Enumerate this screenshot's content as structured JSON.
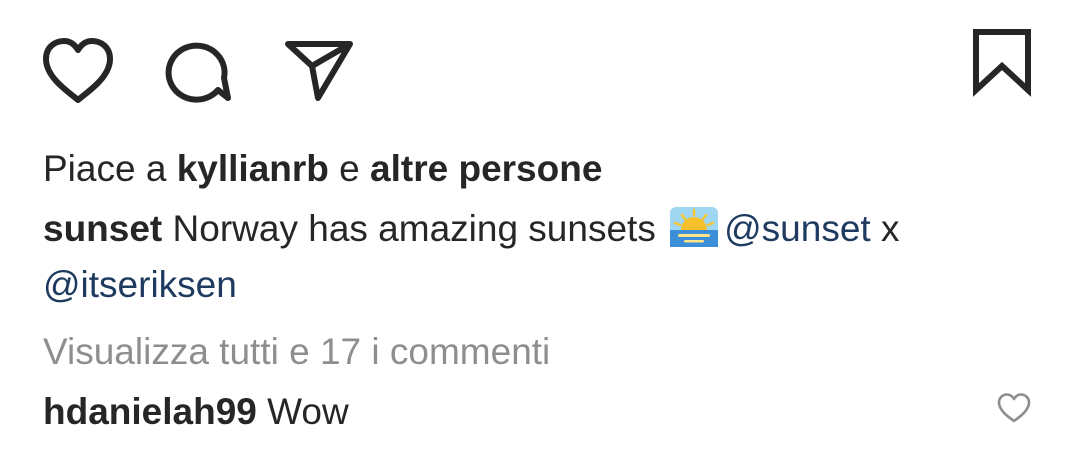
{
  "actions": {
    "like_icon": "heart-icon",
    "comment_icon": "speech-bubble-icon",
    "share_icon": "paper-plane-icon",
    "save_icon": "bookmark-icon"
  },
  "likes": {
    "prefix": "Piace a ",
    "user": "kyllianrb",
    "connector": " e ",
    "others": "altre persone"
  },
  "caption": {
    "username": "sunset",
    "text": "Norway has amazing sunsets",
    "emoji_icon": "sunrise-emoji",
    "mention1": "@sunset",
    "separator": "x",
    "mention2": "@itseriksen"
  },
  "view_comments": "Visualizza tutti e 17 i commenti",
  "comment": {
    "username": "hdanielah99",
    "text": "Wow",
    "like_icon": "heart-icon"
  },
  "colors": {
    "text": "#262626",
    "link": "#1e3a5f",
    "muted": "#8e8e8e"
  }
}
